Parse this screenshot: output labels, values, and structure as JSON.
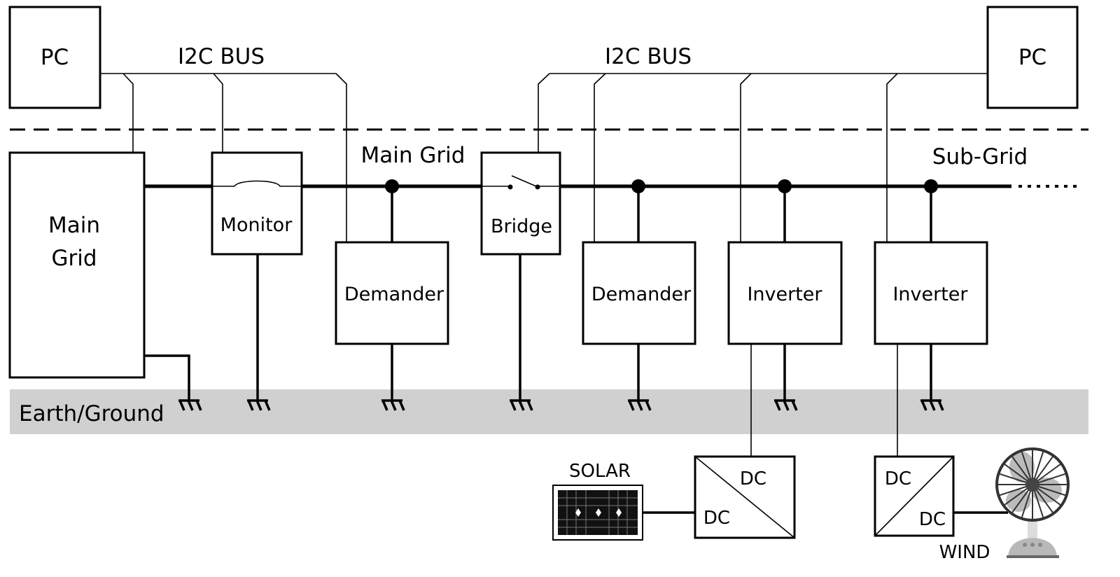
{
  "labels": {
    "pc_left": "PC",
    "pc_right": "PC",
    "i2c_left": "I2C BUS",
    "i2c_right": "I2C BUS",
    "main_grid_box_line1": "Main",
    "main_grid_box_line2": "Grid",
    "main_grid_bus": "Main Grid",
    "sub_grid_bus": "Sub-Grid",
    "monitor": "Monitor",
    "bridge": "Bridge",
    "demander_1": "Demander",
    "demander_2": "Demander",
    "inverter_1": "Inverter",
    "inverter_2": "Inverter",
    "earth": "Earth/Ground",
    "solar": "SOLAR",
    "wind": "WIND",
    "dc1_top": "DC",
    "dc1_bottom": "DC",
    "dc2_top": "DC",
    "dc2_bottom": "DC",
    "continuation": "......"
  },
  "colors": {
    "ground_band": "#d0d0d0",
    "line": "#000000",
    "fan_gray": "#b8b8b8"
  }
}
